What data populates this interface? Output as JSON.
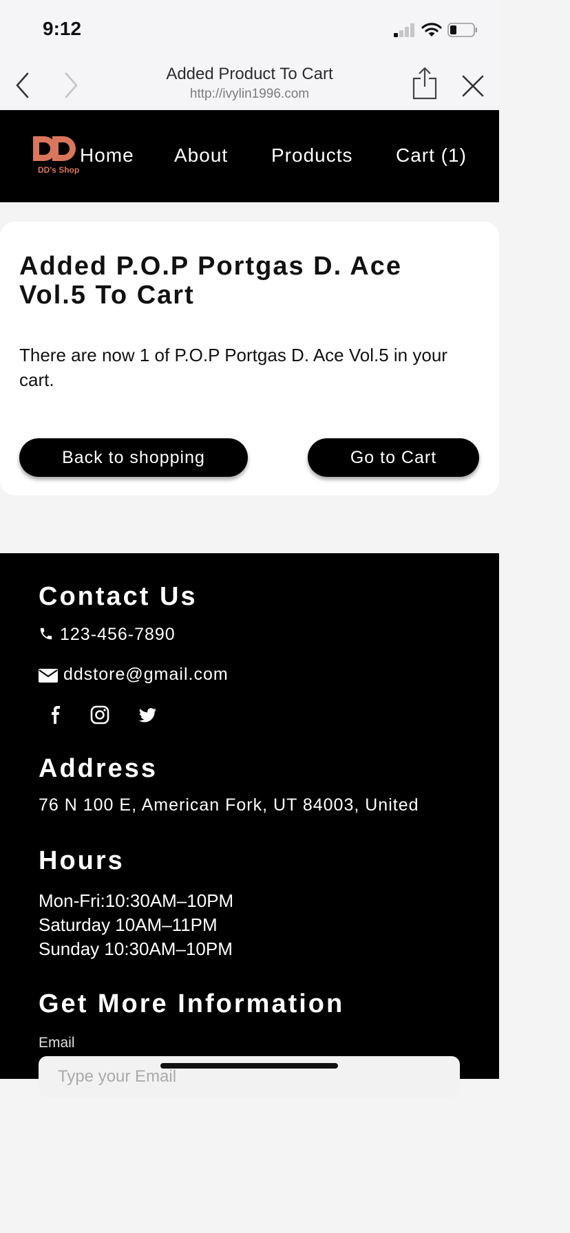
{
  "status_bar": {
    "time": "9:12"
  },
  "browser": {
    "title": "Added Product To Cart",
    "url": "http://ivylin1996.com"
  },
  "site_nav": {
    "logo_text": "DD's Shop",
    "links": [
      "Home",
      "About",
      "Products",
      "Cart (1)"
    ]
  },
  "cart_card": {
    "title": "Added P.O.P Portgas D. Ace Vol.5 To Cart",
    "message": "There are now 1 of P.O.P Portgas D. Ace Vol.5 in your cart.",
    "back_label": "Back to shopping",
    "cart_label": "Go to Cart"
  },
  "footer": {
    "contact_heading": "Contact Us",
    "phone": "123-456-7890",
    "email": "ddstore@gmail.com",
    "address_heading": "Address",
    "address": "76 N 100 E, American Fork, UT 84003, United",
    "hours_heading": "Hours",
    "hours": [
      "Mon-Fri:10:30AM–10PM",
      "Saturday 10AM–11PM",
      "Sunday 10:30AM–10PM"
    ],
    "info_heading": "Get More Information",
    "email_label": "Email",
    "email_placeholder": "Type your Email"
  },
  "colors": {
    "brand_accent": "#d9765c",
    "nav_background": "#000000",
    "page_background": "#f4f4f5"
  },
  "icons": [
    "back-chevron-icon",
    "forward-chevron-icon",
    "share-icon",
    "close-icon",
    "phone-icon",
    "envelope-icon",
    "facebook-icon",
    "instagram-icon",
    "twitter-icon"
  ]
}
